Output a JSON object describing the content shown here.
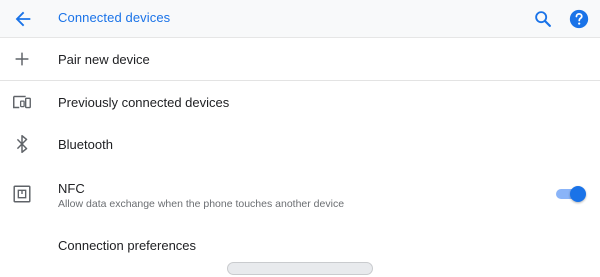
{
  "header": {
    "title": "Connected devices",
    "back_icon": "arrow-back-icon",
    "search_icon": "search-icon",
    "help_icon": "help-icon",
    "accent_color": "#1a73e8"
  },
  "items": [
    {
      "label": "Pair new device",
      "icon": "plus-icon"
    },
    {
      "label": "Previously connected devices",
      "icon": "devices-icon"
    },
    {
      "label": "Bluetooth",
      "icon": "bluetooth-icon"
    },
    {
      "label": "NFC",
      "subtitle": "Allow data exchange when the phone touches another device",
      "icon": "nfc-icon",
      "toggle_on": true
    },
    {
      "label": "Connection preferences"
    }
  ]
}
